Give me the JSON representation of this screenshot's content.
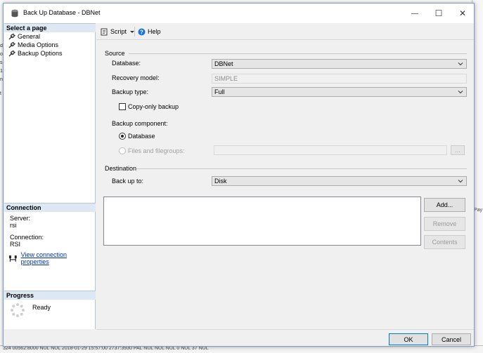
{
  "background": {
    "left_glyphs": [
      "d",
      "o",
      "s",
      "1",
      "n",
      "t"
    ],
    "right_glyph": "Pay",
    "bottom_row": "324    00562:8000    NUL    NUL    2018-01-29 15:57:00    2737:3930    PAL    NUL    NUL    NUL    0    NUL    37    NUL"
  },
  "window": {
    "title": "Back Up Database - DBNet",
    "minimize": "—",
    "maximize": "☐",
    "close": "✕"
  },
  "left_pane": {
    "select_page_heading": "Select a page",
    "pages": [
      {
        "label": "General"
      },
      {
        "label": "Media Options"
      },
      {
        "label": "Backup Options"
      }
    ],
    "connection_heading": "Connection",
    "server_label": "Server:",
    "server_value": "rsi",
    "connection_label": "Connection:",
    "connection_value": "RSI",
    "view_connection_link": "View connection properties",
    "progress_heading": "Progress",
    "progress_status": "Ready"
  },
  "toolbar": {
    "script_label": "Script",
    "help_label": "Help"
  },
  "source": {
    "heading": "Source",
    "database_label": "Database:",
    "database_value": "DBNet",
    "recovery_model_label": "Recovery model:",
    "recovery_model_value": "SIMPLE",
    "backup_type_label": "Backup type:",
    "backup_type_value": "Full",
    "copy_only_label": "Copy-only backup",
    "copy_only_checked": false,
    "backup_component_label": "Backup component:",
    "component_database_label": "Database",
    "component_files_label": "Files and filegroups:",
    "files_browse_label": "..."
  },
  "destination": {
    "heading": "Destination",
    "back_up_to_label": "Back up to:",
    "back_up_to_value": "Disk",
    "add_label": "Add...",
    "remove_label": "Remove",
    "contents_label": "Contents"
  },
  "footer": {
    "ok_label": "OK",
    "cancel_label": "Cancel"
  },
  "colors": {
    "section_header_bg": "#dde8f3",
    "dialog_bg": "#f0f0f0",
    "link": "#0033aa",
    "primary_border": "#0078d7"
  }
}
